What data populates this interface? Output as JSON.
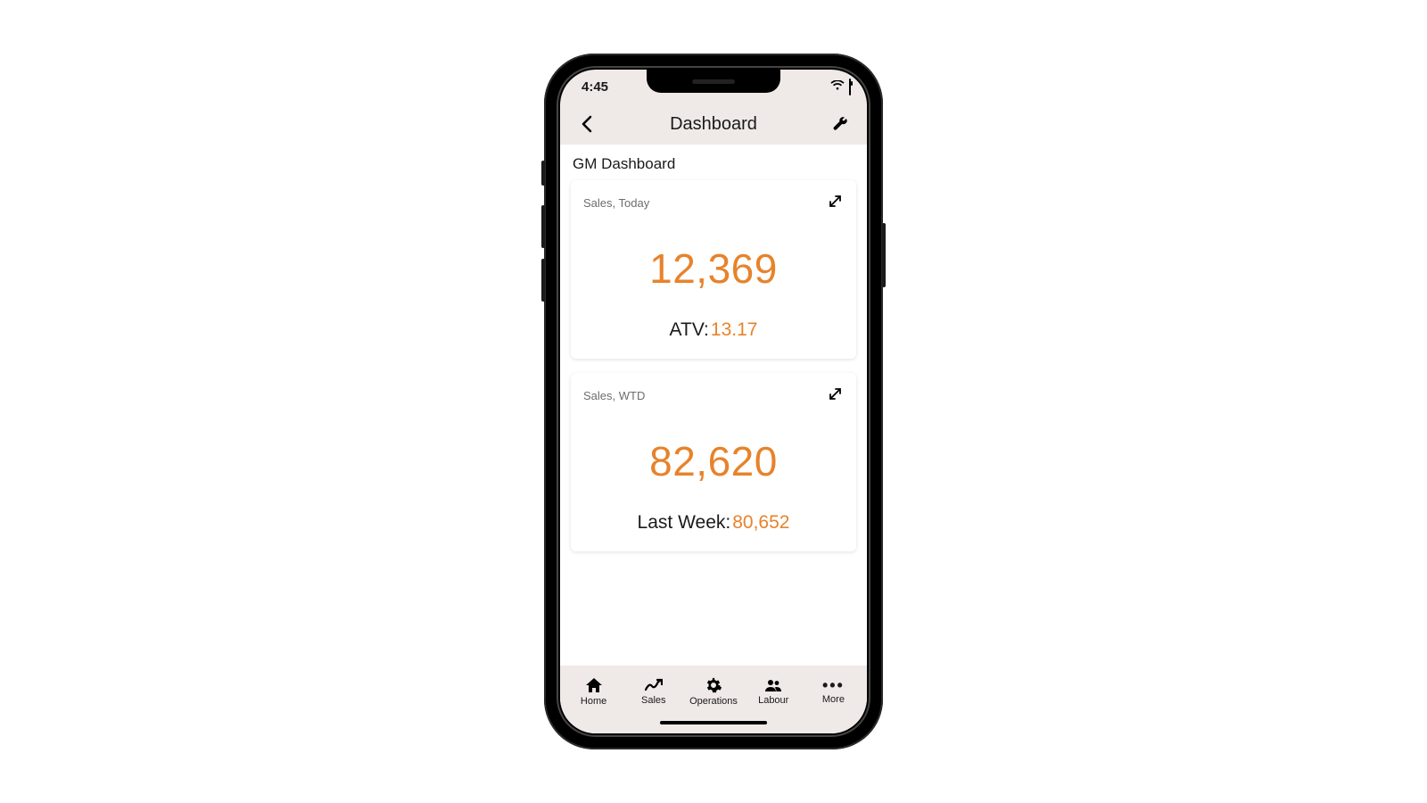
{
  "status": {
    "time": "4:45"
  },
  "nav": {
    "title": "Dashboard"
  },
  "section_title": "GM Dashboard",
  "cards": [
    {
      "label": "Sales, Today",
      "value": "12,369",
      "sub_label": "ATV:",
      "sub_value": "13.17"
    },
    {
      "label": "Sales, WTD",
      "value": "82,620",
      "sub_label": "Last Week:",
      "sub_value": "80,652"
    }
  ],
  "tabs": [
    {
      "label": "Home"
    },
    {
      "label": "Sales"
    },
    {
      "label": "Operations"
    },
    {
      "label": "Labour"
    },
    {
      "label": "More"
    }
  ],
  "colors": {
    "accent": "#E7832B"
  }
}
